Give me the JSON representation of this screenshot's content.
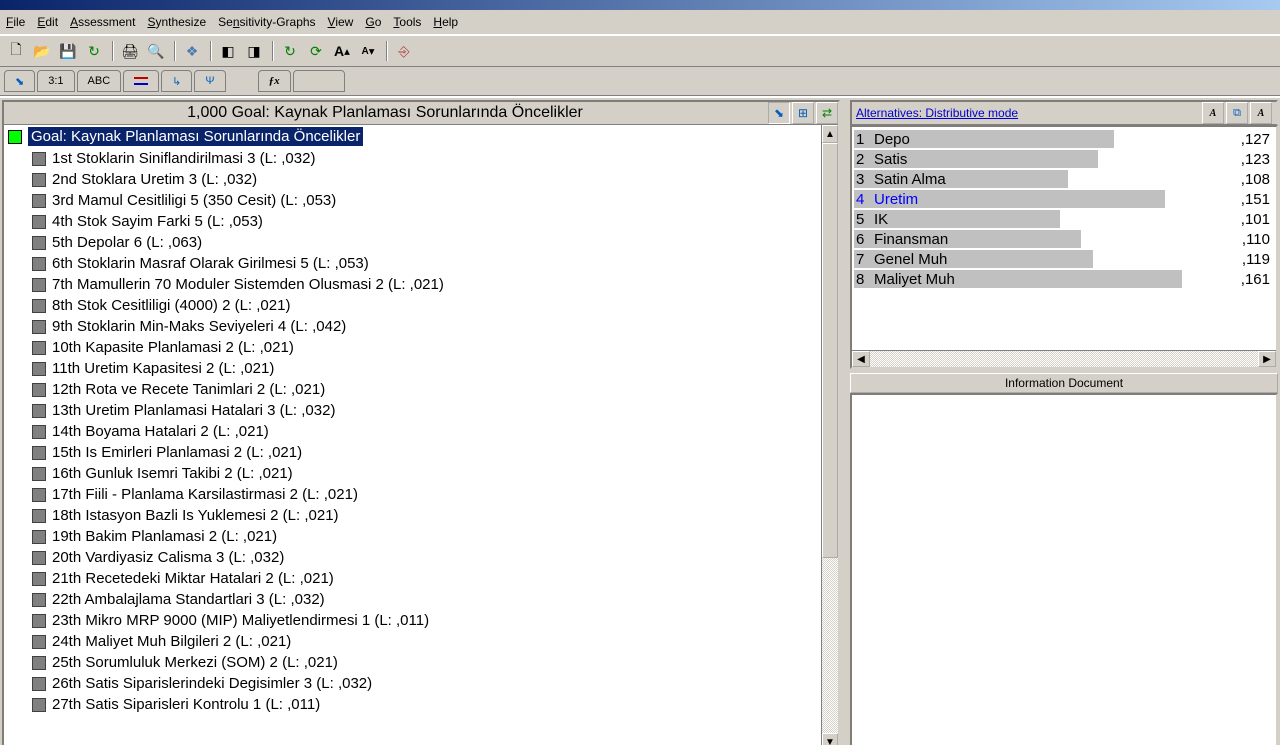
{
  "menu": {
    "items": [
      "File",
      "Edit",
      "Assessment",
      "Synthesize",
      "Sensitivity-Graphs",
      "View",
      "Go",
      "Tools",
      "Help"
    ]
  },
  "toolbar2": {
    "items": [
      "⬊",
      "3:1",
      "ABC",
      "≡",
      "↳",
      "Ψ",
      "",
      "ƒx",
      ""
    ]
  },
  "left": {
    "header_title": "1,000  Goal: Kaynak Planlaması Sorunlarında Öncelikler",
    "root": "Goal: Kaynak Planlaması Sorunlarında Öncelikler",
    "items": [
      "1st Stoklarin Siniflandirilmasi 3 (L: ,032)",
      "2nd Stoklara Uretim 3 (L: ,032)",
      "3rd Mamul Cesitliligi  5 (350 Cesit) (L: ,053)",
      "4th Stok Sayim Farki 5 (L: ,053)",
      "5th Depolar 6 (L: ,063)",
      "6th Stoklarin Masraf Olarak Girilmesi 5 (L: ,053)",
      "7th Mamullerin 70 Moduler Sistemden Olusmasi 2 (L: ,021)",
      "8th Stok Cesitliligi (4000) 2 (L: ,021)",
      "9th Stoklarin Min-Maks Seviyeleri 4 (L: ,042)",
      "10th Kapasite Planlamasi 2 (L: ,021)",
      "11th Uretim Kapasitesi 2 (L: ,021)",
      "12th Rota ve Recete Tanimlari 2 (L: ,021)",
      "13th Uretim Planlamasi Hatalari 3 (L: ,032)",
      "14th Boyama Hatalari 2 (L: ,021)",
      "15th Is Emirleri Planlamasi 2 (L: ,021)",
      "16th Gunluk Isemri Takibi 2 (L: ,021)",
      "17th Fiili - Planlama Karsilastirmasi 2 (L: ,021)",
      "18th Istasyon Bazli Is Yuklemesi 2 (L: ,021)",
      "19th Bakim Planlamasi 2 (L: ,021)",
      "20th Vardiyasiz Calisma 3 (L: ,032)",
      "21th Recetedeki Miktar Hatalari 2 (L: ,021)",
      "22th Ambalajlama Standartlari 3 (L: ,032)",
      "23th Mikro MRP 9000 (MIP) Maliyetlendirmesi 1 (L: ,011)",
      "24th Maliyet Muh Bilgileri 2 (L: ,021)",
      "25th Sorumluluk Merkezi (SOM) 2 (L: ,021)",
      "26th Satis Siparislerindeki Degisimler 3 (L: ,032)",
      "27th Satis Siparisleri Kontrolu 1 (L: ,011)"
    ]
  },
  "alternatives": {
    "link": "Alternatives: Distributive mode",
    "rows": [
      {
        "n": "1",
        "name": "Depo",
        "val": ",127",
        "bar": 62
      },
      {
        "n": "2",
        "name": "Satis",
        "val": ",123",
        "bar": 58
      },
      {
        "n": "3",
        "name": "Satin Alma",
        "val": ",108",
        "bar": 51
      },
      {
        "n": "4",
        "name": "Uretim",
        "val": ",151",
        "bar": 74,
        "hl": true
      },
      {
        "n": "5",
        "name": "IK",
        "val": ",101",
        "bar": 49
      },
      {
        "n": "6",
        "name": "Finansman",
        "val": ",110",
        "bar": 54
      },
      {
        "n": "7",
        "name": "Genel Muh",
        "val": ",119",
        "bar": 57
      },
      {
        "n": "8",
        "name": "Maliyet Muh",
        "val": ",161",
        "bar": 78
      }
    ]
  },
  "info_title": "Information Document",
  "chart_data": {
    "type": "bar",
    "title": "Alternatives: Distributive mode",
    "categories": [
      "Depo",
      "Satis",
      "Satin Alma",
      "Uretim",
      "IK",
      "Finansman",
      "Genel Muh",
      "Maliyet Muh"
    ],
    "values": [
      0.127,
      0.123,
      0.108,
      0.151,
      0.101,
      0.11,
      0.119,
      0.161
    ],
    "xlabel": "",
    "ylabel": "",
    "ylim": [
      0,
      0.2
    ]
  }
}
